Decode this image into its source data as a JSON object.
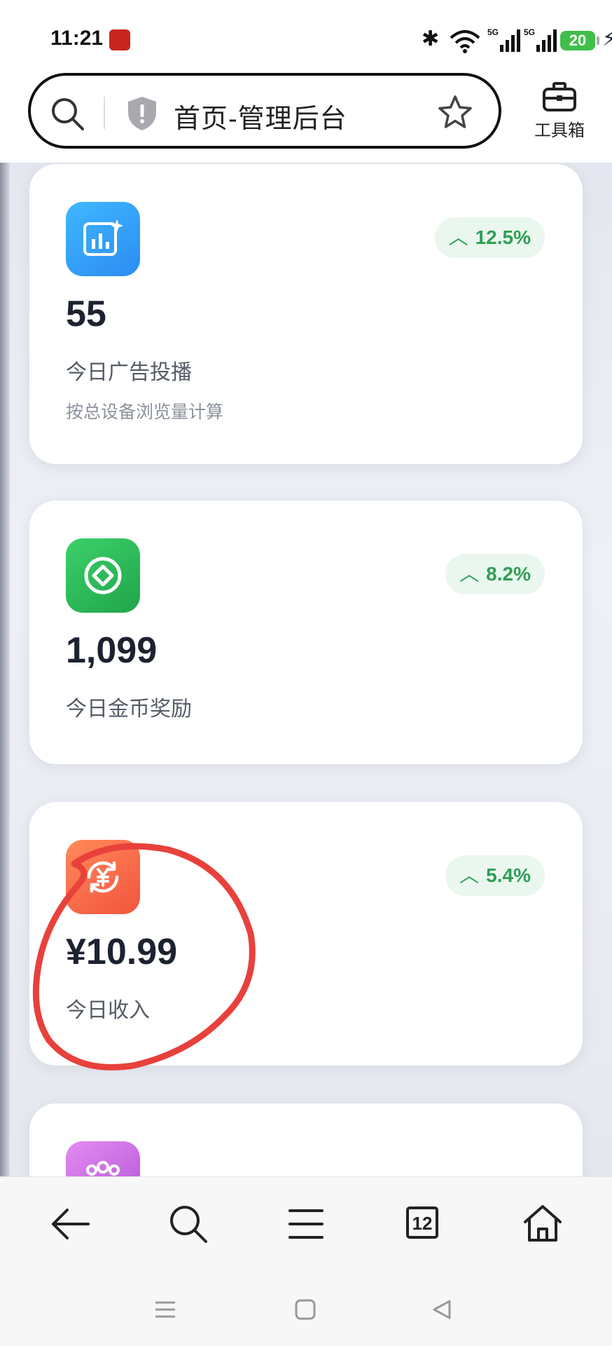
{
  "status_bar": {
    "time": "11:21",
    "battery": "20",
    "net1": "5G",
    "net2": "5G"
  },
  "address_bar": {
    "title": "首页-管理后台"
  },
  "toolbox": {
    "label": "工具箱"
  },
  "cards": [
    {
      "icon": "chart-sparkle-icon",
      "icon_color": "#2c8cf3",
      "change": "12.5%",
      "value": "55",
      "label": "今日广告投播",
      "sub": "按总设备浏览量计算"
    },
    {
      "icon": "coin-icon",
      "icon_color": "#1fa54a",
      "change": "8.2%",
      "value": "1,099",
      "label": "今日金币奖励"
    },
    {
      "icon": "yuan-exchange-icon",
      "icon_color": "#f2543d",
      "change": "5.4%",
      "value": "¥10.99",
      "label": "今日收入"
    },
    {
      "icon": "users-icon",
      "icon_color": "#b24fd8"
    }
  ],
  "colors": {
    "badge_text": "#2e9e55",
    "badge_bg": "#eaf7ef",
    "annotation": "#e8413c"
  },
  "nav": {
    "tabs_count": "12"
  }
}
